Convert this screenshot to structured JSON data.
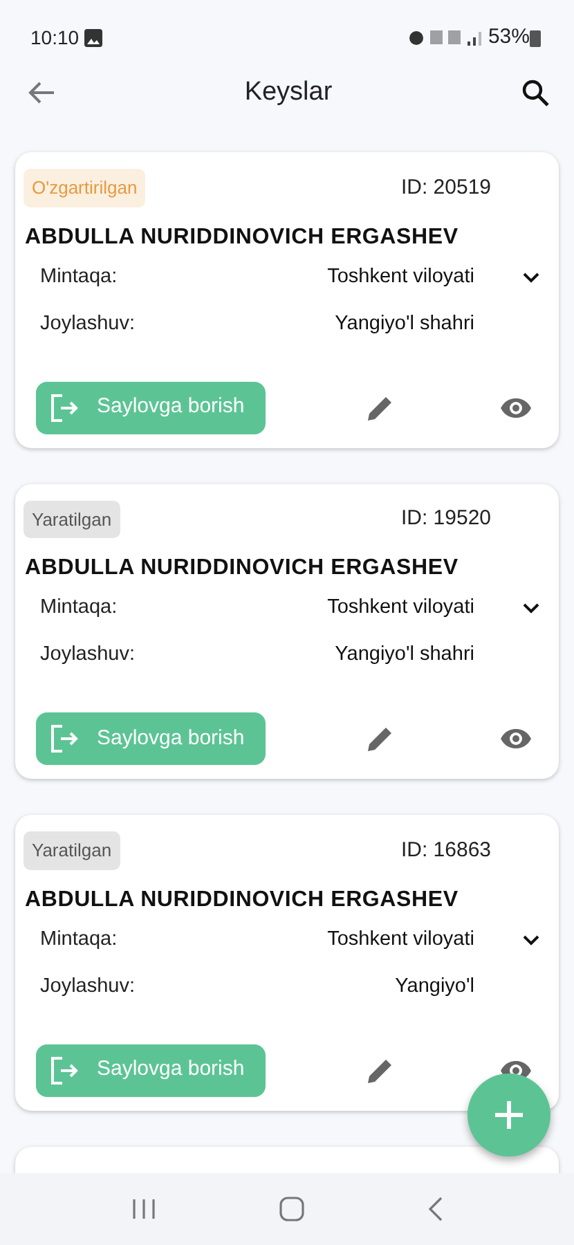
{
  "status_bar": {
    "time": "10:10",
    "battery": "53%"
  },
  "app_bar": {
    "title": "Keyslar"
  },
  "cards": [
    {
      "status": "O'zgartirilgan",
      "color": "#e69b3e",
      "id": "ID: 20519",
      "name": "ABDULLA NURIDDINOVICH ERGASHEV",
      "fields": [
        {
          "label": "Mintaqa:",
          "value": "Toshkent viloyati"
        },
        {
          "label": "Joylashuv:",
          "value": "Yangiyo'l shahri"
        }
      ],
      "action": "Saylovga borish"
    },
    {
      "status": "Yaratilgan",
      "color": "#555555",
      "id": "ID: 19520",
      "name": "ABDULLA NURIDDINOVICH ERGASHEV",
      "fields": [
        {
          "label": "Mintaqa:",
          "value": "Toshkent viloyati"
        },
        {
          "label": "Joylashuv:",
          "value": "Yangiyo'l shahri"
        }
      ],
      "action": "Saylovga borish"
    },
    {
      "status": "Yaratilgan",
      "color": "#555555",
      "id": "ID: 16863",
      "name": "ABDULLA NURIDDINOVICH ERGASHEV",
      "fields": [
        {
          "label": "Mintaqa:",
          "value": "Toshkent viloyati"
        },
        {
          "label": "Joylashuv:",
          "value": "Yangiyo'l"
        }
      ],
      "action": "Saylovga borish"
    }
  ]
}
